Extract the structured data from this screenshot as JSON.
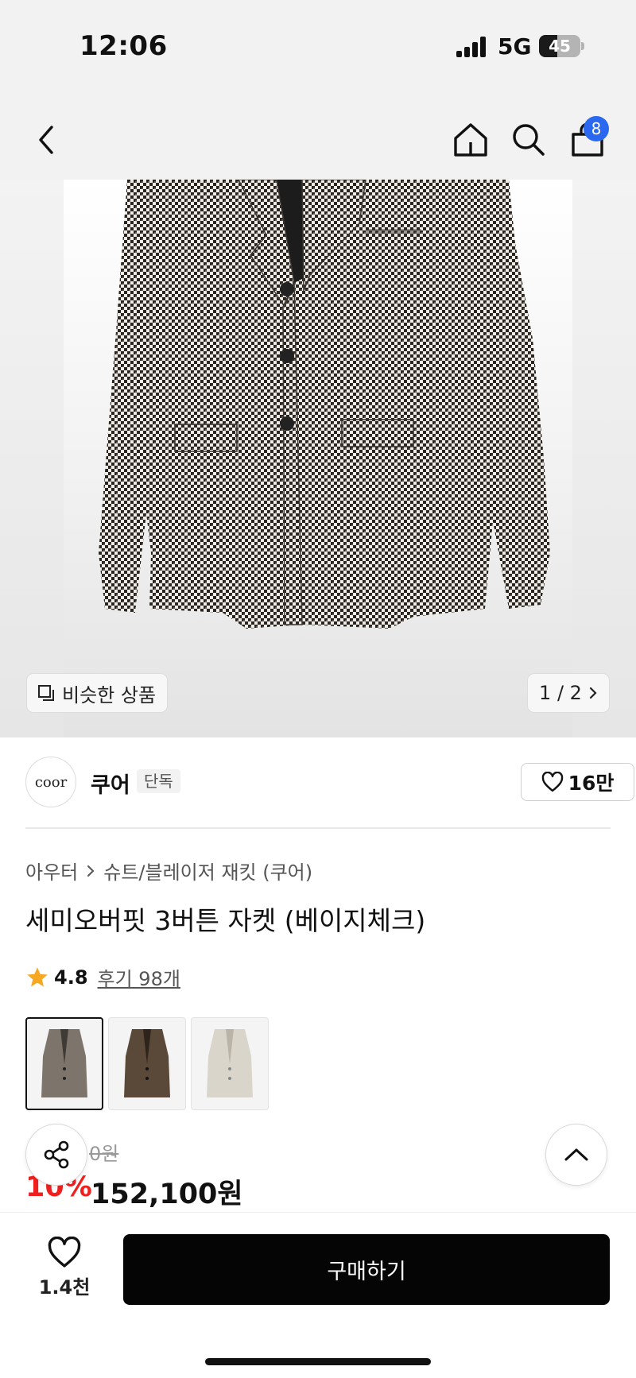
{
  "status_bar": {
    "time": "12:06",
    "network": "5G",
    "battery_level": "45",
    "battery_fraction": 0.45,
    "signal_bars": 4
  },
  "nav": {
    "cart_count": "8",
    "icons": [
      "back-icon",
      "home-icon",
      "search-icon",
      "bag-icon"
    ]
  },
  "hero": {
    "similar_label": "비슷한 상품",
    "page_indicator": "1 / 2"
  },
  "brand": {
    "logo_text": "coor",
    "name": "쿠어",
    "tag": "단독",
    "likes": "16만"
  },
  "breadcrumb": {
    "category": "아우터",
    "subcategory": "슈트/블레이저 재킷 (쿠어)"
  },
  "product": {
    "title": "세미오버핏 3버튼 자켓 (베이지체크)",
    "rating": "4.8",
    "reviews": "후기 98개",
    "thumbnails": [
      {
        "name": "houndstooth-jacket",
        "color": "#7d756b",
        "selected": true
      },
      {
        "name": "brown-check-jacket",
        "color": "#5a4838",
        "selected": false
      },
      {
        "name": "cream-jacket",
        "color": "#d9d5cb",
        "selected": false
      }
    ],
    "original_price": "0원",
    "discount": "10%",
    "price": "152,100원"
  },
  "bottom_bar": {
    "like_count": "1.4천",
    "buy_label": "구매하기"
  },
  "colors": {
    "accent_blue": "#2a68f0",
    "discount_red": "#f0201f",
    "star": "#f7a823",
    "buy_button": "#050505"
  }
}
